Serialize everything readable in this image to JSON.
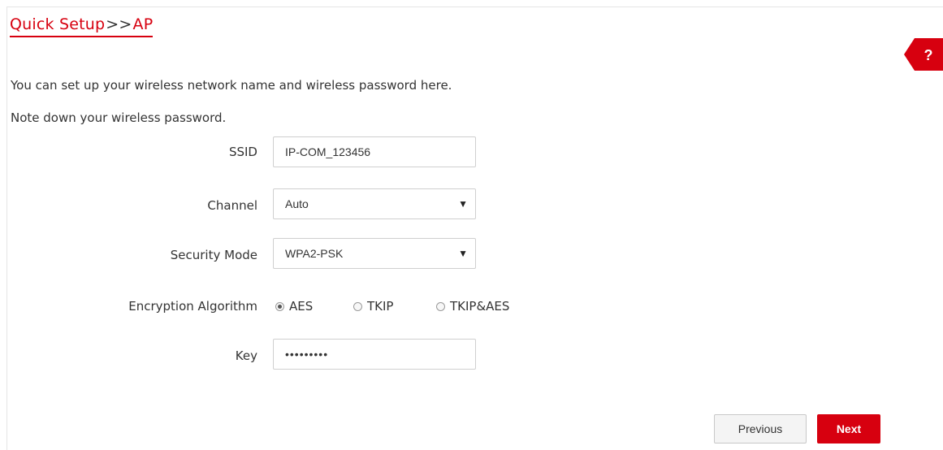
{
  "header": {
    "title_part1": "Quick Setup",
    "title_sep": ">>",
    "title_part2": "AP"
  },
  "help": {
    "label": "?",
    "icon": "help-icon"
  },
  "intro": {
    "line1": "You can set up your wireless network name and wireless password here.",
    "line2": "Note down your wireless password."
  },
  "form": {
    "ssid": {
      "label": "SSID",
      "value": "IP-COM_123456"
    },
    "channel": {
      "label": "Channel",
      "value": "Auto"
    },
    "security_mode": {
      "label": "Security Mode",
      "value": "WPA2-PSK"
    },
    "encryption": {
      "label": "Encryption Algorithm",
      "options": [
        "AES",
        "TKIP",
        "TKIP&AES"
      ],
      "selected": "AES"
    },
    "key": {
      "label": "Key",
      "value": "•••••••••"
    }
  },
  "buttons": {
    "previous": "Previous",
    "next": "Next"
  },
  "colors": {
    "accent": "#d7000f",
    "text": "#333333",
    "border": "#cfcfcf"
  }
}
